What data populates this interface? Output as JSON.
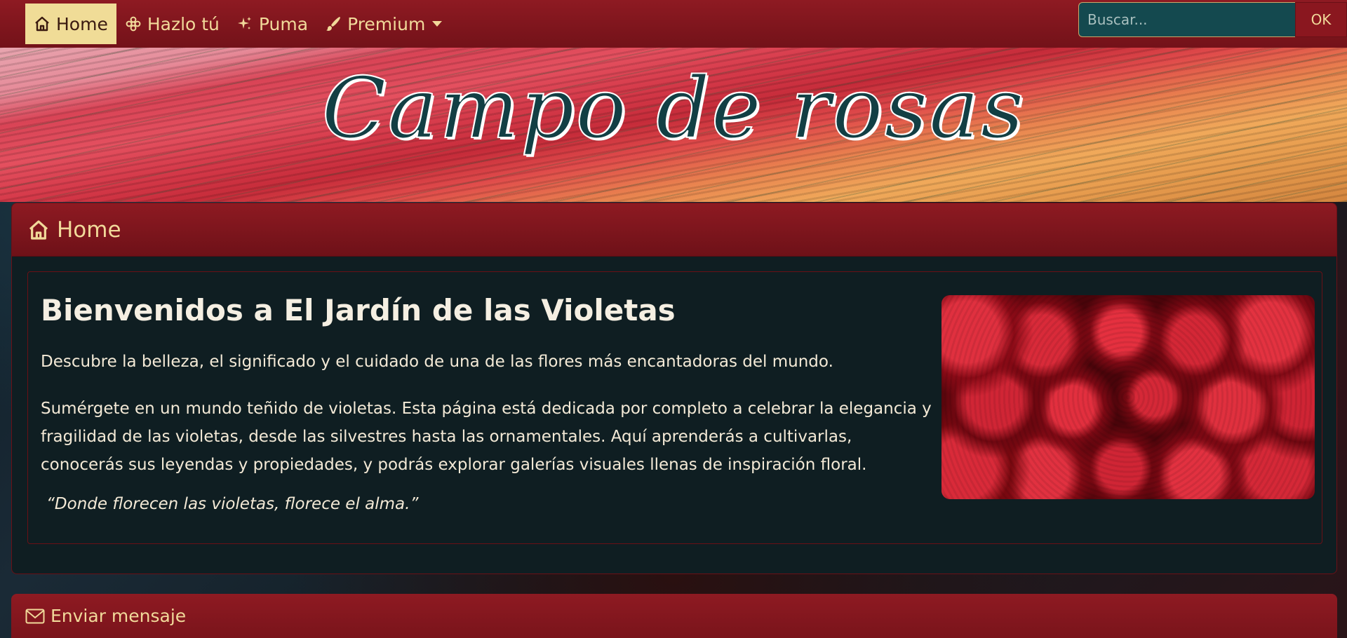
{
  "navbar": {
    "items": [
      {
        "label": "Home",
        "icon": "home-icon",
        "active": true
      },
      {
        "label": "Hazlo tú",
        "icon": "flower-icon",
        "active": false
      },
      {
        "label": "Puma",
        "icon": "sparkles-icon",
        "active": false
      },
      {
        "label": "Premium",
        "icon": "brush-icon",
        "active": false,
        "dropdown": true
      }
    ],
    "search": {
      "placeholder": "Buscar...",
      "button_label": "OK"
    }
  },
  "banner": {
    "title": "Campo de rosas"
  },
  "home_card": {
    "header": "Home",
    "welcome_title": "Bienvenidos a El Jardín de las Violetas",
    "subtitle": "Descubre la belleza, el significado y el cuidado de una de las flores más encantadoras del mundo.",
    "description": "Sumérgete en un mundo teñido de violetas. Esta página está dedicada por completo a celebrar la elegancia y fragilidad de las violetas, desde las silvestres hasta las ornamentales. Aquí aprenderás a cultivarlas, conocerás sus leyendas y propiedades, y podrás explorar galerías visuales llenas de inspiración floral.",
    "quote": "“Donde florecen las violetas, florece el alma.”"
  },
  "message_card": {
    "header": "Enviar mensaje"
  },
  "colors": {
    "nav_bg": "#8e1a22",
    "nav_text": "#f1d99a",
    "active_bg": "#f0dc97",
    "card_bg": "#0f1e22",
    "title_fill": "#123f44"
  }
}
